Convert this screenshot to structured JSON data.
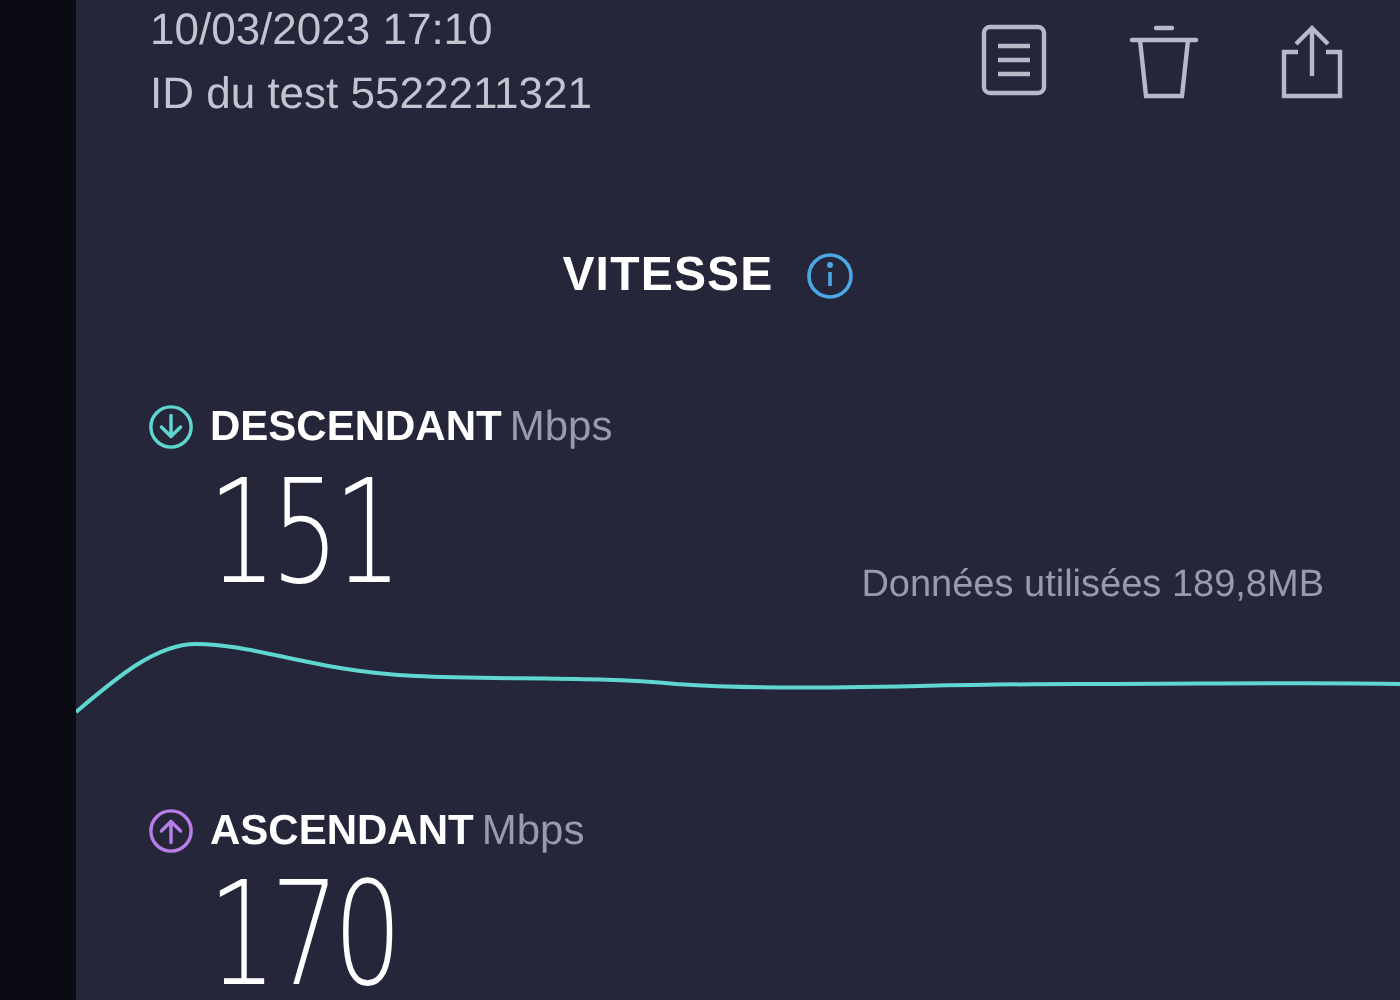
{
  "header": {
    "date": "10/03/2023 17:10",
    "test_id": "ID du test 5522211321"
  },
  "section_title": "VITESSE",
  "metrics": [
    {
      "kind": "download",
      "label": "DESCENDANT",
      "unit": "Mbps",
      "value": "151",
      "data_used": "Données utilisées 189,8MB"
    },
    {
      "kind": "upload",
      "label": "ASCENDANT",
      "unit": "Mbps",
      "value": "170"
    }
  ]
}
